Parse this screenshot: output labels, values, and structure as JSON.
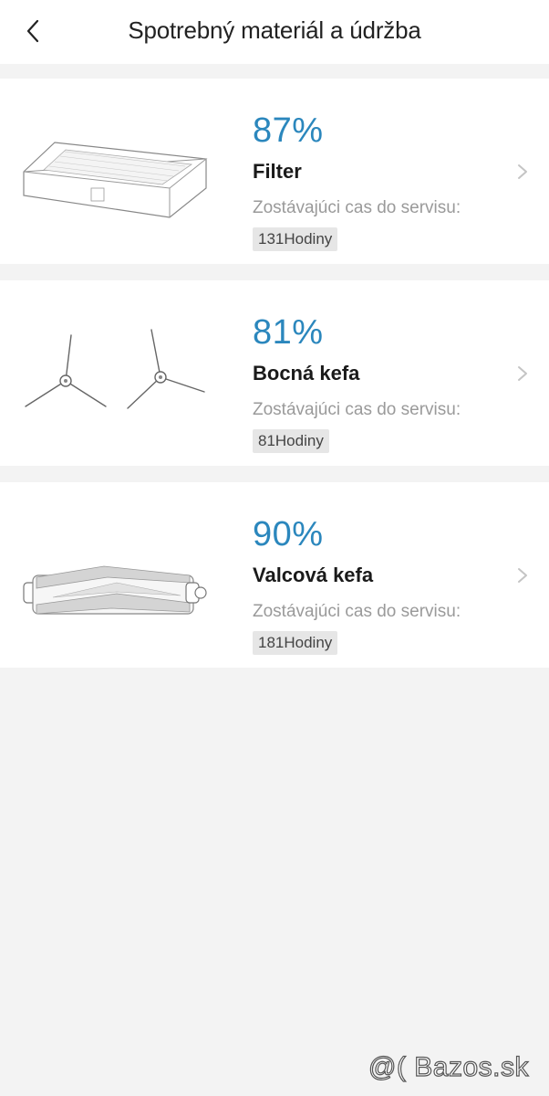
{
  "header": {
    "title": "Spotrebný materiál a údržba"
  },
  "items": [
    {
      "percent": "87%",
      "name": "Filter",
      "remaining_label": "Zostávajúci cas do servisu:",
      "hours": "131Hodiny",
      "icon": "filter-illustration"
    },
    {
      "percent": "81%",
      "name": "Bocná kefa",
      "remaining_label": "Zostávajúci cas do servisu:",
      "hours": "81Hodiny",
      "icon": "side-brush-illustration"
    },
    {
      "percent": "90%",
      "name": "Valcová kefa",
      "remaining_label": "Zostávajúci cas do servisu:",
      "hours": "181Hodiny",
      "icon": "roller-brush-illustration"
    }
  ],
  "watermark": "@( Bazos.sk",
  "colors": {
    "accent": "#2b87bd",
    "background": "#f3f3f3",
    "card": "#ffffff"
  }
}
